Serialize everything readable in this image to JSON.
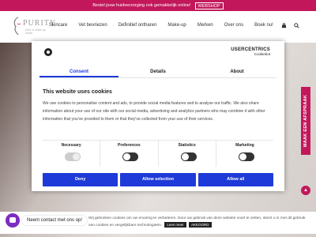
{
  "topbar": {
    "text": "Bestel jouw huidverzorging ook gemakkelijk online!",
    "shop_label": "WEBSHOP"
  },
  "logo": {
    "word": "PURITY",
    "subtitle": "huid- & make-up studio"
  },
  "nav": {
    "items": [
      "Skincare",
      "Vet bevriezen",
      "Definitief ontharen",
      "Make-up",
      "Merken",
      "Over ons",
      "Boek nu!"
    ],
    "cart_icon": "shopping-bag-icon",
    "search_icon": "search-icon"
  },
  "modal": {
    "brand_name": "USERCENTRICS",
    "brand_sub": "Cookiebot",
    "tabs": [
      "Consent",
      "Details",
      "About"
    ],
    "heading": "This website uses cookies",
    "body": "We use cookies to personalise content and ads, to provide social media features and to analyse our traffic. We also share information about your use of our site with our social media, advertising and analytics partners who may combine it with other information that you've provided to them or that they've collected from your use of their services.",
    "categories": [
      "Necessary",
      "Preferences",
      "Statistics",
      "Marketing"
    ],
    "buttons": {
      "deny": "Deny",
      "selection": "Allow selection",
      "all": "Allow all"
    }
  },
  "side_tab": {
    "label": "MAAK EEN AFSPRAAK"
  },
  "cookie_bar": {
    "text": "Wij gebruiken cookies om uw ervaring te verbeteren. Door uw gebruik van deze website voort te zetten, stemt u in met dit gebruik van cookies en vergelijkbare technologieën.",
    "read_more": "Lees meer",
    "agree": "AKKOORD"
  },
  "chat": {
    "label": "Neem contact met ons op!"
  },
  "colors": {
    "accent": "#c2185b",
    "button_blue": "#1e3ad8",
    "chat_purple": "#7b2cbf"
  }
}
